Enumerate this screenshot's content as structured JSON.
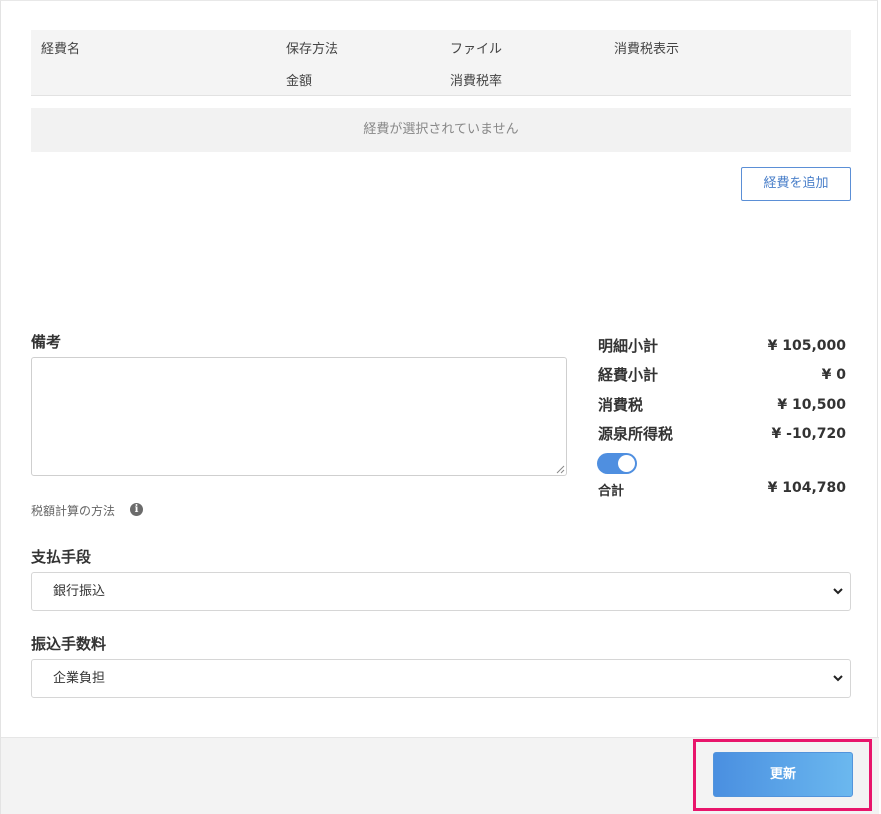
{
  "expense_table": {
    "headers_row1": [
      "経費名",
      "保存方法",
      "ファイル",
      "消費税表示"
    ],
    "headers_row2": [
      "金額",
      "消費税率"
    ],
    "empty_message": "経費が選択されていません",
    "add_button_label": "経費を追加"
  },
  "remarks": {
    "label": "備考",
    "value": ""
  },
  "tax_method": {
    "label": "税額計算の方法",
    "icon": "info-icon"
  },
  "summary": {
    "detail_subtotal_label": "明細小計",
    "detail_subtotal_value": "¥ 105,000",
    "expense_subtotal_label": "経費小計",
    "expense_subtotal_value": "¥ 0",
    "consumption_tax_label": "消費税",
    "consumption_tax_value": "¥ 10,500",
    "withholding_tax_label": "源泉所得税",
    "withholding_tax_value": "¥ -10,720",
    "withholding_toggle_on": true,
    "total_label": "合計",
    "total_value": "¥ 104,780"
  },
  "payment_method": {
    "label": "支払手段",
    "selected": "銀行振込"
  },
  "transfer_fee": {
    "label": "振込手数料",
    "selected": "企業負担"
  },
  "footer": {
    "update_button_label": "更新"
  },
  "colors": {
    "accent": "#4f8fe0",
    "highlight": "#e8156b",
    "panel_bg": "#f3f3f3"
  }
}
